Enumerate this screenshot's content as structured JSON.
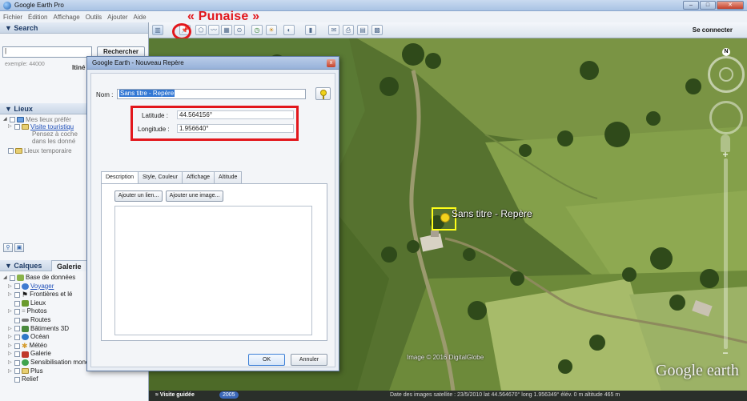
{
  "window": {
    "title": "Google Earth Pro",
    "min_label": "–",
    "max_label": "□",
    "close_label": "✕"
  },
  "menu": [
    "Fichier",
    "Édition",
    "Affichage",
    "Outils",
    "Ajouter",
    "Aide"
  ],
  "search": {
    "header": "▼ Search",
    "input_value": "|",
    "button": "Rechercher",
    "hint": "exemple: 44000",
    "itinerary": "Itiné"
  },
  "places": {
    "header": "▼ Lieux",
    "items": [
      {
        "label": "Mes lieux préfér"
      },
      {
        "label": "Visite touristiqu"
      },
      {
        "label": "Pensez à coche"
      },
      {
        "label": "dans les donné"
      },
      {
        "label": "Lieux temporaire"
      }
    ]
  },
  "layers": {
    "tab1": "▼ Calques",
    "tab2": "Galerie",
    "items": [
      {
        "label": "Base de données",
        "color": "#8bb34a"
      },
      {
        "label": "Voyager",
        "color": "#3f7bd0"
      },
      {
        "label": "Frontières et lé",
        "color": "#555555"
      },
      {
        "label": "Lieux",
        "color": "#6b9b2e"
      },
      {
        "label": "Photos",
        "color": "#999999"
      },
      {
        "label": "Routes",
        "color": "#777777"
      },
      {
        "label": "Bâtiments 3D",
        "color": "#4a8a3c"
      },
      {
        "label": "Océan",
        "color": "#2f78c8"
      },
      {
        "label": "Météo",
        "color": "#d49a2a"
      },
      {
        "label": "Galerie",
        "color": "#c0392b"
      },
      {
        "label": "Sensibilisation mondiale",
        "color": "#3fa34d"
      },
      {
        "label": "Plus",
        "color": "#e0c050"
      },
      {
        "label": "Relief",
        "color": "#8d8d8d"
      }
    ]
  },
  "toolbar": {
    "annotation": "« Punaise »",
    "signin": "Se connecter"
  },
  "map": {
    "placemark_label": "Sans titre - Repère",
    "credit": "Image © 2016 DigitalGlobe",
    "logo": "Google earth",
    "north": "N"
  },
  "status": {
    "tour": "≈ Visite guidée",
    "year": "2005",
    "info": "Date des images satellite : 23/5/2010   lat  44.564670°  long   1.956349°  élév.   0 m   altitude   465 m"
  },
  "dialog": {
    "title": "Google Earth - Nouveau Repère",
    "close": "x",
    "name_label": "Nom :",
    "name_value": "Sans titre - Repère",
    "latitude_label": "Latitude :",
    "latitude_value": "44.564156°",
    "longitude_label": "Longitude :",
    "longitude_value": "1.956640°",
    "tabs": [
      "Description",
      "Style, Couleur",
      "Affichage",
      "Altitude"
    ],
    "add_link": "Ajouter un lien...",
    "add_image": "Ajouter une image...",
    "ok": "OK",
    "cancel": "Annuler"
  },
  "colors": {
    "annotation_red": "#e2171c",
    "placemark_yellow": "#ffff1a"
  }
}
